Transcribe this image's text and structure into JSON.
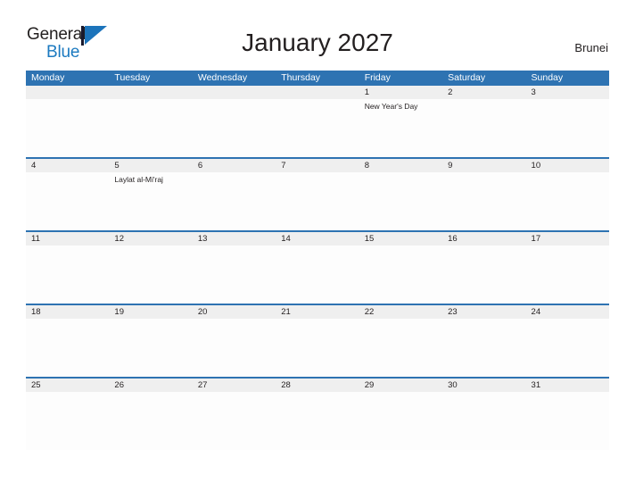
{
  "brand": {
    "word_one": "General",
    "word_two": "Blue",
    "mark": "triangle-logo",
    "accent_color": "#1c74bb"
  },
  "header": {
    "title": "January 2027",
    "country": "Brunei"
  },
  "calendar": {
    "header_color": "#2e73b2",
    "date_band_color": "#efefef",
    "weekdays": [
      "Monday",
      "Tuesday",
      "Wednesday",
      "Thursday",
      "Friday",
      "Saturday",
      "Sunday"
    ],
    "weeks": [
      {
        "days": [
          {
            "date": "",
            "events": []
          },
          {
            "date": "",
            "events": []
          },
          {
            "date": "",
            "events": []
          },
          {
            "date": "",
            "events": []
          },
          {
            "date": "1",
            "events": [
              "New Year's Day"
            ]
          },
          {
            "date": "2",
            "events": []
          },
          {
            "date": "3",
            "events": []
          }
        ]
      },
      {
        "days": [
          {
            "date": "4",
            "events": []
          },
          {
            "date": "5",
            "events": [
              "Laylat al-Mi'raj"
            ]
          },
          {
            "date": "6",
            "events": []
          },
          {
            "date": "7",
            "events": []
          },
          {
            "date": "8",
            "events": []
          },
          {
            "date": "9",
            "events": []
          },
          {
            "date": "10",
            "events": []
          }
        ]
      },
      {
        "days": [
          {
            "date": "11",
            "events": []
          },
          {
            "date": "12",
            "events": []
          },
          {
            "date": "13",
            "events": []
          },
          {
            "date": "14",
            "events": []
          },
          {
            "date": "15",
            "events": []
          },
          {
            "date": "16",
            "events": []
          },
          {
            "date": "17",
            "events": []
          }
        ]
      },
      {
        "days": [
          {
            "date": "18",
            "events": []
          },
          {
            "date": "19",
            "events": []
          },
          {
            "date": "20",
            "events": []
          },
          {
            "date": "21",
            "events": []
          },
          {
            "date": "22",
            "events": []
          },
          {
            "date": "23",
            "events": []
          },
          {
            "date": "24",
            "events": []
          }
        ]
      },
      {
        "days": [
          {
            "date": "25",
            "events": []
          },
          {
            "date": "26",
            "events": []
          },
          {
            "date": "27",
            "events": []
          },
          {
            "date": "28",
            "events": []
          },
          {
            "date": "29",
            "events": []
          },
          {
            "date": "30",
            "events": []
          },
          {
            "date": "31",
            "events": []
          }
        ]
      }
    ]
  }
}
